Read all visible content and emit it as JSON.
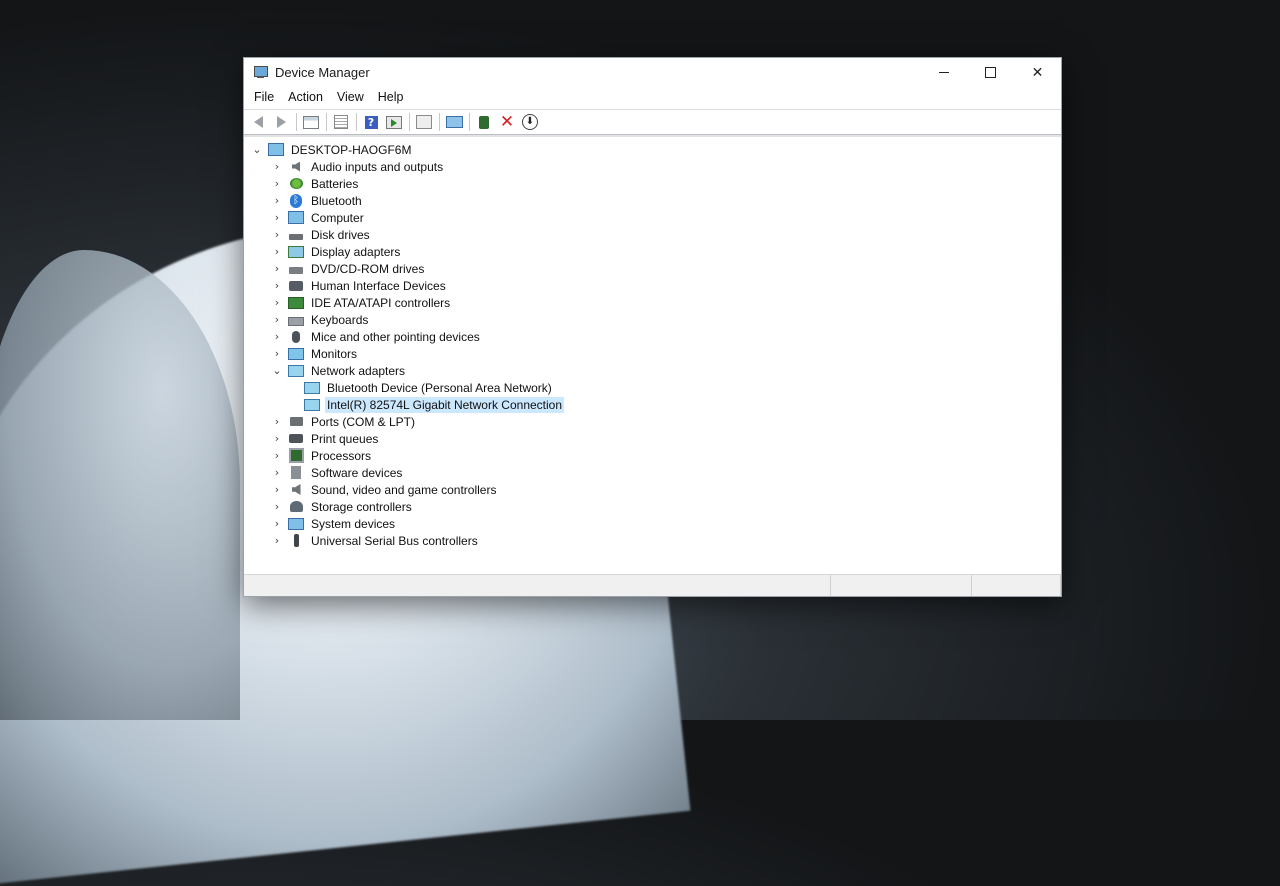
{
  "window": {
    "title": "Device Manager"
  },
  "window_controls": {
    "minimize": "minimize",
    "maximize": "maximize",
    "close": "✕"
  },
  "menu": [
    "File",
    "Action",
    "View",
    "Help"
  ],
  "toolbar": {
    "buttons": [
      {
        "name": "back-button",
        "icon": "arrow-left-icon"
      },
      {
        "name": "forward-button",
        "icon": "arrow-right-icon"
      },
      {
        "name": "show-hide-tree-button",
        "icon": "console-tree-icon"
      },
      {
        "name": "properties-button",
        "icon": "properties-icon"
      },
      {
        "name": "help-button",
        "icon": "help-icon",
        "glyph": "?"
      },
      {
        "name": "run-button",
        "icon": "run-icon"
      },
      {
        "name": "scan-hardware-button",
        "icon": "scan-hardware-icon"
      },
      {
        "name": "computer-button",
        "icon": "monitor-icon"
      },
      {
        "name": "update-driver-button",
        "icon": "update-driver-icon"
      },
      {
        "name": "uninstall-device-button",
        "icon": "uninstall-icon",
        "glyph": "✕"
      },
      {
        "name": "disable-device-button",
        "icon": "download-icon",
        "glyph": "⬇"
      }
    ]
  },
  "tree": {
    "root": "DESKTOP-HAOGF6M",
    "categories": [
      {
        "label": "Audio inputs and outputs",
        "icon": "speaker-icon"
      },
      {
        "label": "Batteries",
        "icon": "battery-icon"
      },
      {
        "label": "Bluetooth",
        "icon": "bluetooth-icon"
      },
      {
        "label": "Computer",
        "icon": "computer-icon"
      },
      {
        "label": "Disk drives",
        "icon": "disk-drive-icon"
      },
      {
        "label": "Display adapters",
        "icon": "display-adapter-icon"
      },
      {
        "label": "DVD/CD-ROM drives",
        "icon": "dvd-drive-icon"
      },
      {
        "label": "Human Interface Devices",
        "icon": "hid-icon"
      },
      {
        "label": "IDE ATA/ATAPI controllers",
        "icon": "ide-controller-icon"
      },
      {
        "label": "Keyboards",
        "icon": "keyboard-icon"
      },
      {
        "label": "Mice and other pointing devices",
        "icon": "mouse-icon"
      },
      {
        "label": "Monitors",
        "icon": "monitor-icon"
      },
      {
        "label": "Network adapters",
        "icon": "network-adapter-icon",
        "expanded": true,
        "children": [
          {
            "label": "Bluetooth Device (Personal Area Network)",
            "icon": "network-adapter-icon"
          },
          {
            "label": "Intel(R) 82574L Gigabit Network Connection",
            "icon": "network-adapter-icon",
            "selected": true
          }
        ]
      },
      {
        "label": "Ports (COM & LPT)",
        "icon": "port-icon"
      },
      {
        "label": "Print queues",
        "icon": "printer-icon"
      },
      {
        "label": "Processors",
        "icon": "processor-icon"
      },
      {
        "label": "Software devices",
        "icon": "software-device-icon"
      },
      {
        "label": "Sound, video and game controllers",
        "icon": "sound-icon"
      },
      {
        "label": "Storage controllers",
        "icon": "storage-controller-icon"
      },
      {
        "label": "System devices",
        "icon": "system-device-icon"
      },
      {
        "label": "Universal Serial Bus controllers",
        "icon": "usb-icon"
      }
    ]
  }
}
